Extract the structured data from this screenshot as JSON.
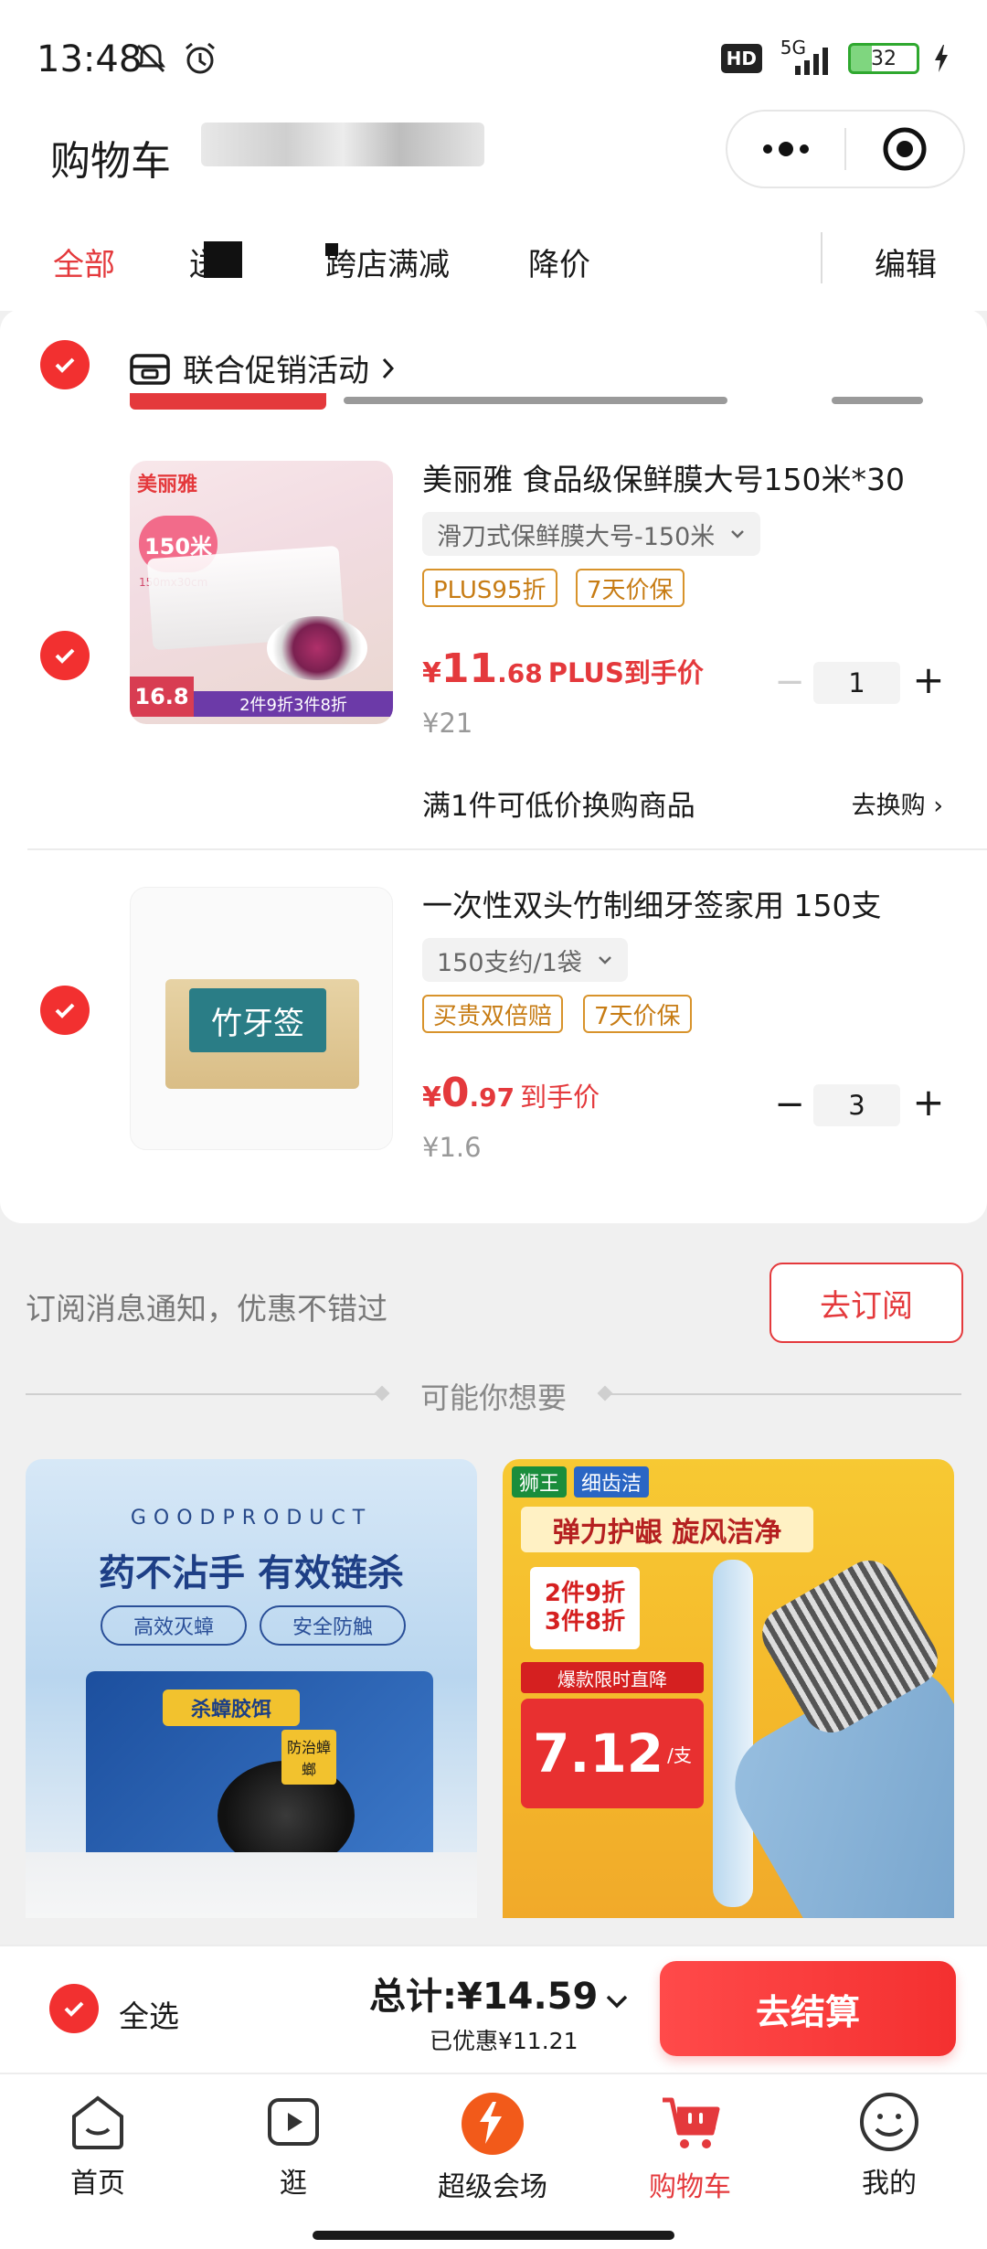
{
  "status_bar": {
    "time": "13:48",
    "network": "5G",
    "battery": "32"
  },
  "header": {
    "title": "购物车"
  },
  "tabs": [
    {
      "label": "全部"
    },
    {
      "label": ""
    },
    {
      "label": "跨店满减"
    },
    {
      "label": "降价"
    }
  ],
  "edit_label": "编辑",
  "promo": {
    "label": "联合促销活动"
  },
  "products": [
    {
      "title": "美丽雅 食品级保鲜膜大号150米*30",
      "spec": "滑刀式保鲜膜大号-150米",
      "tags": [
        "PLUS95折",
        "7天价保"
      ],
      "price_yen": "¥",
      "price_int": "11",
      "price_dec": ".68",
      "price_suffix": "PLUS到手价",
      "original_price": "¥21",
      "quantity": "1",
      "image_badges": {
        "brand": "美丽雅",
        "length": "150米",
        "size": "150mx30cm",
        "price": "16.8",
        "offer": "2件9折3件8折"
      }
    },
    {
      "title": "一次性双头竹制细牙签家用 150支",
      "spec": "150支约/1袋",
      "tags": [
        "买贵双倍赔",
        "7天价保"
      ],
      "price_yen": "¥",
      "price_int": "0",
      "price_dec": ".97",
      "price_suffix": "到手价",
      "original_price": "¥1.6",
      "quantity": "3",
      "image_badges": {
        "label": "竹牙签"
      }
    }
  ],
  "swap": {
    "text": "满1件可低价换购商品",
    "link": "去换购"
  },
  "subscribe": {
    "text": "订阅消息通知，优惠不错过",
    "button": "去订阅"
  },
  "recommend": {
    "title": "可能你想要"
  },
  "rec_left": {
    "brand": "GOODPRODUCT",
    "headline": "药不沾手 有效链杀",
    "badge1": "高效灭蟑",
    "badge2": "安全防触",
    "product": "杀蟑胶饵",
    "sub": "防治蟑螂"
  },
  "rec_right": {
    "brand": "狮王",
    "brand2": "细齿洁",
    "headline": "弹力护龈 旋风洁净",
    "offer": "2件9折\n3件8折",
    "deal": "爆款限时直降",
    "price": "7.12",
    "unit": "/支"
  },
  "checkout": {
    "select_all": "全选",
    "total": "总计:¥14.59",
    "saved": "已优惠¥11.21",
    "button": "去结算"
  },
  "tab_bar": [
    {
      "label": "首页"
    },
    {
      "label": "逛"
    },
    {
      "label": "超级会场"
    },
    {
      "label": "购物车"
    },
    {
      "label": "我的"
    }
  ],
  "colors": {
    "accent": "#e4393c",
    "tag": "#c77c14"
  }
}
